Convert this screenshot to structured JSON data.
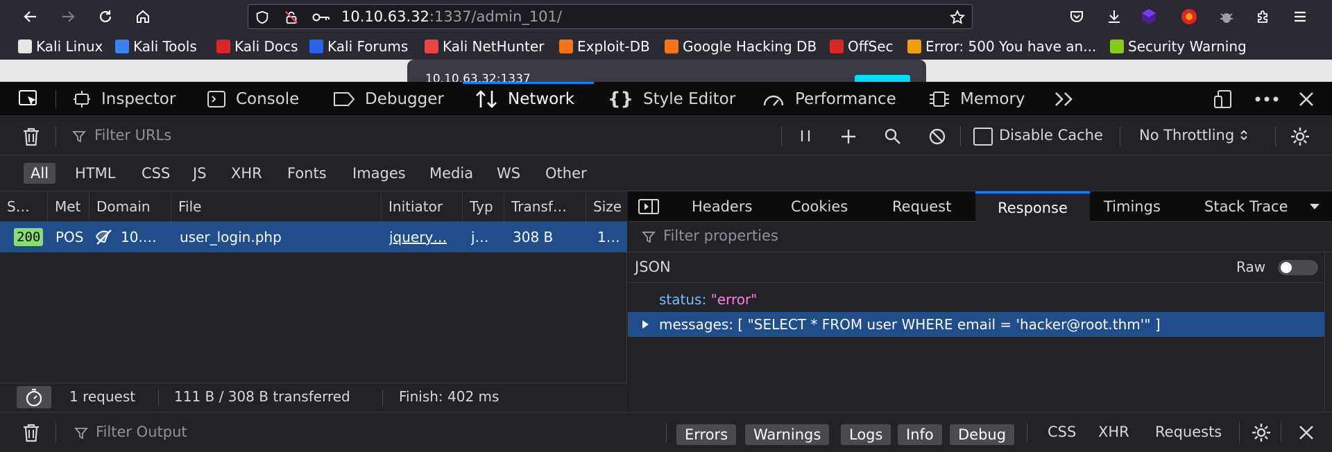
{
  "browser": {
    "url_host": "10.10.63.32",
    "url_rest": ":1337/admin_101/",
    "bookmarks": [
      {
        "label": "Kali Linux",
        "color": "#e5e5e5"
      },
      {
        "label": "Kali Tools",
        "color": "#3b82f6"
      },
      {
        "label": "Kali Docs",
        "color": "#dc2626"
      },
      {
        "label": "Kali Forums",
        "color": "#2563eb"
      },
      {
        "label": "Kali NetHunter",
        "color": "#ef4444"
      },
      {
        "label": "Exploit-DB",
        "color": "#f97316"
      },
      {
        "label": "Google Hacking DB",
        "color": "#f97316"
      },
      {
        "label": "OffSec",
        "color": "#dc2626"
      },
      {
        "label": "Error: 500 You have an...",
        "color": "#f59e0b"
      },
      {
        "label": "Security Warning",
        "color": "#84cc16"
      }
    ]
  },
  "page": {
    "popup_text": "10.10.63.32:1337"
  },
  "devtools": {
    "tabs": {
      "inspector": "Inspector",
      "console": "Console",
      "debugger": "Debugger",
      "network": "Network",
      "style_editor": "Style Editor",
      "performance": "Performance",
      "memory": "Memory"
    },
    "filter_placeholder": "Filter URLs",
    "disable_cache": "Disable Cache",
    "throttling": "No Throttling",
    "type_filters": [
      "All",
      "HTML",
      "CSS",
      "JS",
      "XHR",
      "Fonts",
      "Images",
      "Media",
      "WS",
      "Other"
    ],
    "columns": {
      "status": "S…",
      "method": "Met",
      "domain": "Domain",
      "file": "File",
      "initiator": "Initiator",
      "type": "Typ",
      "transferred": "Transf…",
      "size": "Size"
    },
    "request": {
      "status": "200",
      "method": "POS",
      "domain": "10.…",
      "file": "user_login.php",
      "initiator": "jquery…",
      "type": "j…",
      "transferred": "308 B",
      "size": "1…"
    },
    "summary": {
      "requests": "1 request",
      "transferred": "111 B / 308 B transferred",
      "finish": "Finish: 402 ms"
    },
    "response_tabs": [
      "Headers",
      "Cookies",
      "Request",
      "Response",
      "Timings",
      "Stack Trace"
    ],
    "prop_filter_placeholder": "Filter properties",
    "json_label": "JSON",
    "raw_label": "Raw",
    "json": {
      "status_key": "status:",
      "status_val": "\"error\"",
      "messages_key": "messages:",
      "messages_val": "[ \"SELECT * FROM user WHERE email = 'hacker@root.thm'\" ]"
    },
    "console": {
      "filter_placeholder": "Filter Output",
      "levels": [
        "Errors",
        "Warnings",
        "Logs",
        "Info",
        "Debug"
      ],
      "extras": [
        "CSS",
        "XHR",
        "Requests"
      ]
    }
  }
}
